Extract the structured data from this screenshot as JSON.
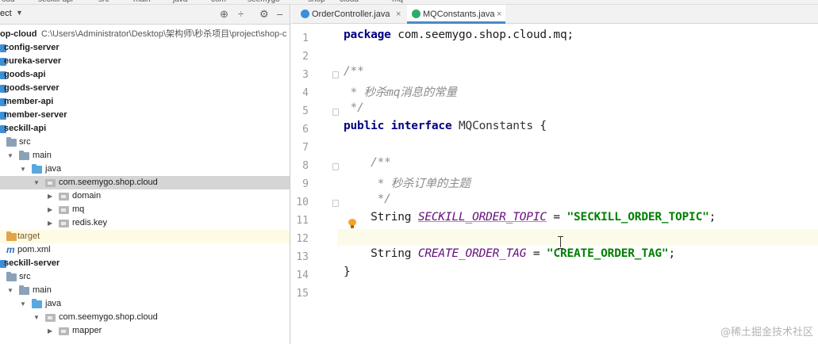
{
  "breadcrumbs": [
    "oud",
    "seckill-api",
    "src",
    "main",
    "java",
    "com",
    "seemygo",
    "shop",
    "cloud",
    "mq"
  ],
  "project_panel": {
    "title": "ect",
    "root": {
      "name": "op-cloud",
      "path": "C:\\Users\\Administrator\\Desktop\\架构师\\秒杀项目\\project\\shop-c"
    },
    "items": [
      {
        "label": "config-server",
        "kind": "module"
      },
      {
        "label": "eureka-server",
        "kind": "module"
      },
      {
        "label": "goods-api",
        "kind": "module"
      },
      {
        "label": "goods-server",
        "kind": "module"
      },
      {
        "label": "member-api",
        "kind": "module"
      },
      {
        "label": "member-server",
        "kind": "module"
      },
      {
        "label": "seckill-api",
        "kind": "module"
      },
      {
        "label": "src",
        "kind": "folder"
      },
      {
        "label": "main",
        "kind": "folder"
      },
      {
        "label": "java",
        "kind": "source-folder"
      },
      {
        "label": "com.seemygo.shop.cloud",
        "kind": "package"
      },
      {
        "label": "domain",
        "kind": "package"
      },
      {
        "label": "mq",
        "kind": "package"
      },
      {
        "label": "redis.key",
        "kind": "package"
      },
      {
        "label": "target",
        "kind": "excluded-folder"
      },
      {
        "label": "pom.xml",
        "kind": "maven-file"
      },
      {
        "label": "seckill-server",
        "kind": "module"
      },
      {
        "label": "src",
        "kind": "folder"
      },
      {
        "label": "main",
        "kind": "folder"
      },
      {
        "label": "java",
        "kind": "source-folder"
      },
      {
        "label": "com.seemygo.shop.cloud",
        "kind": "package"
      },
      {
        "label": "mapper",
        "kind": "package"
      }
    ]
  },
  "tabs": [
    {
      "label": "OrderController.java",
      "active": false,
      "icon": "class-icon"
    },
    {
      "label": "MQConstants.java",
      "active": true,
      "icon": "interface-icon"
    }
  ],
  "editor": {
    "line_numbers": [
      "1",
      "2",
      "3",
      "4",
      "5",
      "6",
      "7",
      "8",
      "9",
      "10",
      "11",
      "12",
      "13",
      "14",
      "15"
    ],
    "code": {
      "l1_kw": "package",
      "l1_rest": " com.seemygo.shop.cloud.mq;",
      "l3": "/**",
      "l4": " * 秒杀mq消息的常量",
      "l5": " */",
      "l6_kw1": "public",
      "l6_kw2": " interface",
      "l6_name": " MQConstants",
      "l6_brace": " {",
      "l8": "    /**",
      "l9": "     * 秒杀订单的主题",
      "l10": "     */",
      "l11_type": "    String ",
      "l11_name": "SECKILL_ORDER_TOPIC",
      "l11_eq": " = ",
      "l11_val": "\"SECKILL_ORDER_TOPIC\"",
      "l11_end": ";",
      "l13_type": "    String ",
      "l13_name": "CREATE_ORDER_TAG",
      "l13_eq": " = ",
      "l13_val": "\"CREATE_ORDER_TAG\"",
      "l13_end": ";",
      "l14": "}"
    }
  },
  "watermark": "@稀土掘金技术社区",
  "colors": {
    "keyword": "#000080",
    "comment": "#8c8c8c",
    "string": "#008000",
    "constant": "#660e7a",
    "selection": "#d5d5d5",
    "current_line": "#fcfbe9",
    "active_tab_underline": "#4a88c7"
  }
}
